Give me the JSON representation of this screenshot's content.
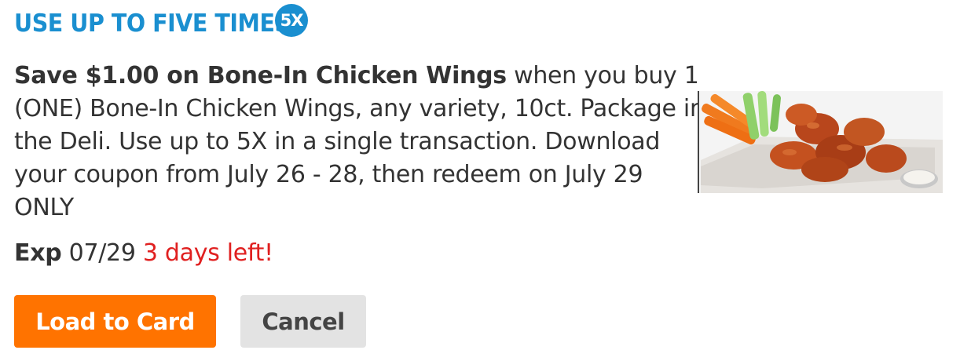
{
  "header": {
    "title": "USE UP TO FIVE TIMES",
    "badge": "5X"
  },
  "offer": {
    "headline": "Save $1.00 on Bone-In Chicken Wings",
    "body": " when you buy 1 (ONE) Bone-In Chicken Wings, any variety, 10ct. Package in the Deli. Use up to 5X in a single transaction. Download your coupon from July 26 - 28, then redeem on July 29 ONLY"
  },
  "expiry": {
    "label": "Exp",
    "date": "07/29",
    "days_left": "3 days left!"
  },
  "buttons": {
    "load": "Load to Card",
    "cancel": "Cancel"
  },
  "image": {
    "icon": "chicken-wings-photo"
  },
  "colors": {
    "accent_blue": "#1a8fd0",
    "button_orange": "#ff7300",
    "warning_red": "#e02020",
    "cancel_gray": "#e3e3e3"
  }
}
